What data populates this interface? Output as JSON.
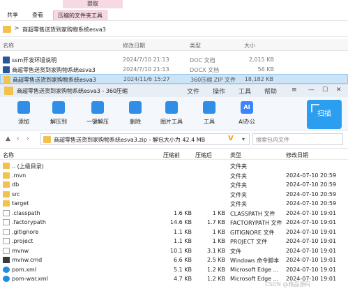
{
  "ribbon": {
    "context_tab": "提取",
    "tabs": [
      "共享",
      "查看",
      "压缩的文件夹工具"
    ]
  },
  "address": {
    "separator": ">",
    "path": "商超零售送货到家购物系统esva3"
  },
  "explorer": {
    "columns": {
      "name": "名称",
      "date": "修改日期",
      "type": "类型",
      "size": "大小"
    },
    "files": [
      {
        "name": "ssm开发环境说明",
        "date": "2024/7/10 21:13",
        "type": "DOC 文档",
        "size": "2,015 KB",
        "icon": "word-icon"
      },
      {
        "name": "商超零售送货到家购物系统esva3",
        "date": "2024/7/10 21:13",
        "type": "DOCX 文档",
        "size": "56 KB",
        "icon": "word-icon"
      },
      {
        "name": "商超零售送货到家购物系统esva3",
        "date": "2024/11/6 15:27",
        "type": "360压缩 ZIP 文件",
        "size": "18,182 KB",
        "icon": "zip-icon"
      }
    ]
  },
  "zip_window": {
    "title": "商超零售送货到家购物系统esva3 - 360压缩",
    "controls": [
      "文件",
      "操作",
      "工具",
      "帮助"
    ],
    "toolbar": [
      {
        "label": "添加",
        "icon": "add-icon"
      },
      {
        "label": "解压到",
        "icon": "extract-to-icon"
      },
      {
        "label": "一键解压",
        "icon": "one-click-extract-icon"
      },
      {
        "label": "删除",
        "icon": "delete-icon"
      },
      {
        "label": "图片工具",
        "icon": "image-tool-icon"
      },
      {
        "label": "工具",
        "icon": "tools-icon"
      },
      {
        "label": "AI办公",
        "icon": "ai-office-icon",
        "glyph": "AI"
      }
    ],
    "scan_label": "扫描",
    "zip_path": "商超零售送货到家购物系统esva3.zip - 解包大小为 42.4 MB",
    "search_placeholder": "搜索包内文件",
    "columns": {
      "name": "名称",
      "packed": "压缩前",
      "unpacked": "压缩后",
      "type": "类型",
      "modified": "修改日期"
    },
    "entries": [
      {
        "name": ".. (上级目录)",
        "packed": "",
        "unpacked": "",
        "type": "文件夹",
        "modified": "",
        "icon": "folder"
      },
      {
        "name": ".mvn",
        "packed": "",
        "unpacked": "",
        "type": "文件夹",
        "modified": "2024-07-10 20:59",
        "icon": "folder"
      },
      {
        "name": "db",
        "packed": "",
        "unpacked": "",
        "type": "文件夹",
        "modified": "2024-07-10 20:59",
        "icon": "folder"
      },
      {
        "name": "src",
        "packed": "",
        "unpacked": "",
        "type": "文件夹",
        "modified": "2024-07-10 20:59",
        "icon": "folder"
      },
      {
        "name": "target",
        "packed": "",
        "unpacked": "",
        "type": "文件夹",
        "modified": "2024-07-10 20:59",
        "icon": "folder"
      },
      {
        "name": ".classpath",
        "packed": "1.6 KB",
        "unpacked": "1 KB",
        "type": "CLASSPATH 文件",
        "modified": "2024-07-10 19:01",
        "icon": "file"
      },
      {
        "name": ".factorypath",
        "packed": "14.6 KB",
        "unpacked": "1.7 KB",
        "type": "FACTORYPATH 文件",
        "modified": "2024-07-10 19:01",
        "icon": "file"
      },
      {
        "name": ".gitignore",
        "packed": "1.1 KB",
        "unpacked": "1 KB",
        "type": "GITIGNORE 文件",
        "modified": "2024-07-10 19:01",
        "icon": "file"
      },
      {
        "name": ".project",
        "packed": "1.1 KB",
        "unpacked": "1 KB",
        "type": "PROJECT 文件",
        "modified": "2024-07-10 19:01",
        "icon": "file"
      },
      {
        "name": "mvnw",
        "packed": "10.1 KB",
        "unpacked": "3.1 KB",
        "type": "文件",
        "modified": "2024-07-10 19:01",
        "icon": "mvnw"
      },
      {
        "name": "mvnw.cmd",
        "packed": "6.6 KB",
        "unpacked": "2.5 KB",
        "type": "Windows 命令脚本",
        "modified": "2024-07-10 19:01",
        "icon": "cmd"
      },
      {
        "name": "pom.xml",
        "packed": "5.1 KB",
        "unpacked": "1.2 KB",
        "type": "Microsoft Edge ...",
        "modified": "2024-07-10 19:01",
        "icon": "edge"
      },
      {
        "name": "pom-war.xml",
        "packed": "4.7 KB",
        "unpacked": "1.2 KB",
        "type": "Microsoft Edge ...",
        "modified": "2024-07-10 19:01",
        "icon": "edge"
      }
    ]
  },
  "watermark": "CSDN @精品源码"
}
